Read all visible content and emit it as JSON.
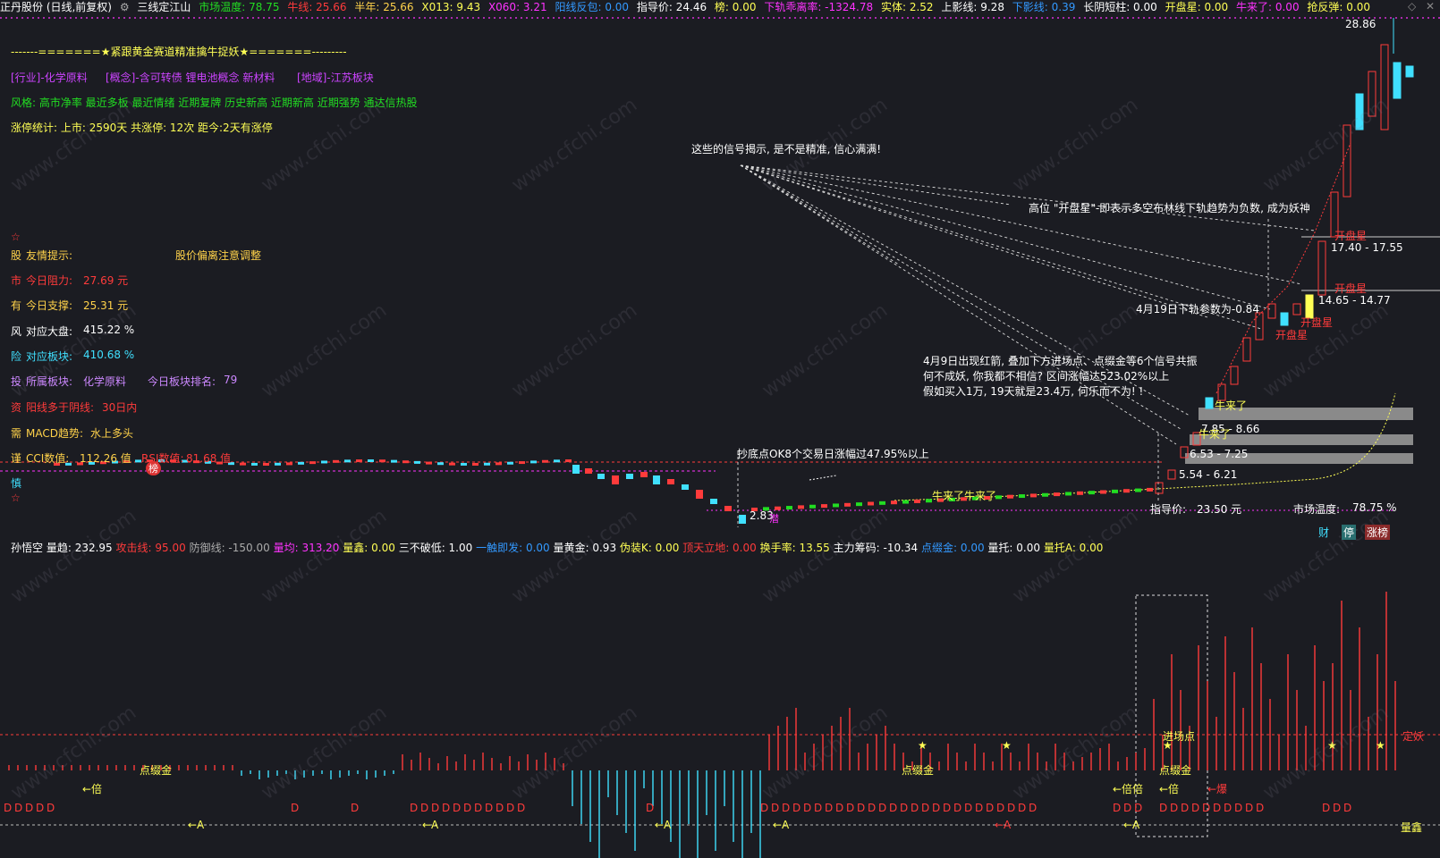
{
  "topbar": {
    "stock_name": "正丹股份 (日线,前复权)",
    "settings_icon": "gear-icon",
    "indicator_name": "三线定江山",
    "market_temp": "市场温度: 78.75",
    "bull_line": "牛线: 25.66",
    "half_year": "半年: 25.66",
    "x013": "X013: 9.43",
    "x060": "X060: 3.21",
    "yang_fan": "阳线反包: 0.00",
    "guide_price": "指导价: 24.46",
    "bang": "榜: 0.00",
    "lower_rail_rate": "下轨乖离率: -1324.78",
    "solid": "实体: 2.52",
    "upper_shadow": "上影线: 9.28",
    "lower_shadow": "下影线: 0.39",
    "long_short": "长阴短柱: 0.00",
    "open_star": "开盘星: 0.00",
    "bull_came": "牛来了: 0.00",
    "rebound": "抢反弹: 0.00"
  },
  "info": {
    "banner": "-------=======★紧跟黄金赛道精准擒牛捉妖★=======---------",
    "industry": "[行业]-化学原料",
    "concept": "[概念]-含可转债 锂电池概念 新材料",
    "region": "[地域]-江苏板块",
    "style": "风格: 高市净率 最近多板 最近情绪 近期复牌 历史新高 近期新高 近期强势 通达信热股",
    "limit_stats": "涨停统计:    上市: 2590天    共涨停: 12次    距今:2天有涨停",
    "star1": "☆",
    "tip_label": "友情提示:",
    "tip_value": "股价偏离注意调整",
    "resist_label": "今日阻力:",
    "resist_value": "27.69 元",
    "support_label": "今日支撑:",
    "support_value": "25.31 元",
    "market_label": "对应大盘:",
    "market_value": "415.22 %",
    "sector_label": "对应板块:",
    "sector_value": "410.68 %",
    "belong_label": "所属板块:",
    "belong_value": "化学原料",
    "rank_label": "今日板块排名:",
    "rank_value": "79",
    "yang_label": "阳线多于阴线:",
    "yang_value": "30日内",
    "macd_label": "MACD趋势:",
    "macd_value": "水上多头",
    "cci_label": "CCI数值:",
    "cci_value": "112.26 值",
    "rsi_label": "RSI数值:",
    "rsi_value": "81.68 值",
    "side_chars": [
      "股",
      "市",
      "有",
      "风",
      "险",
      "投",
      "资",
      "需",
      "谨",
      "慎"
    ],
    "star2": "☆"
  },
  "annotations": {
    "signal_title": "这些的信号揭示, 是不是精准, 信心满满!",
    "high_open_star": "高位 \"开盘星\"-即表示多空布林线下轨趋势为负数, 成为妖神",
    "apr19": "4月19日下轨参数为-0.84",
    "apr9_1": "4月9日出现红箭, 叠加下方进场点、点缀金等6个信号共振",
    "apr9_2": "何不成妖, 你我都不相信? 区间涨幅达523.02%以上",
    "apr9_3": "假如买入1万, 19天就是23.4万, 何乐而不为! !",
    "bottom_note": "抄底点OK8个交易日涨幅过47.95%以上",
    "price_high": "28.86",
    "range1": "17.40 - 17.55",
    "range2": "14.65 - 14.77",
    "range3": "7.85 - 8.66",
    "range4": "6.53 - 7.25",
    "range5": "5.54 - 6.21",
    "low_price": "2.83",
    "open_star_a": "开盘星",
    "open_star_b": "开盘星",
    "open_star_c": "开盘星",
    "open_star_d": "开盘星",
    "bull_came_a": "牛来了",
    "bull_came_b": "牛来了",
    "bull_came_c": "牛来了",
    "bull_came_d": "牛来了",
    "guide_label": "指导价:",
    "guide_value": "23.50 元",
    "temp_label": "市场温度:",
    "temp_value": "78.75 %",
    "cai": "财",
    "ting": "停",
    "zhangting": "涨榜",
    "bang_tag": "榜",
    "jian_tag": "潜"
  },
  "sub": {
    "name": "孙悟空",
    "vol_trend": "量趋: 232.95",
    "attack": "攻击线: 95.00",
    "defense": "防御线: -150.00",
    "vol_avg": "量均: 313.20",
    "vol_xin": "量鑫: 0.00",
    "three_nobreak": "三不破低: 1.00",
    "touch": "一触即发: 0.00",
    "vol_gold": "量黄金: 0.93",
    "fake_k": "伪装K: 0.00",
    "top_sky": "顶天立地: 0.00",
    "turnover": "换手率: 13.55",
    "main_chip": "主力筹码: -10.34",
    "dot_gold": "点缀金: 0.00",
    "vol_support": "量托: 0.00",
    "vol_support_a": "量托A: 0.00",
    "labels": {
      "bei1": "←倍",
      "dianzhui1": "点缀金",
      "dianzhui2": "点缀金",
      "dianzhui3": "点缀金",
      "jinchang": "进场点",
      "beibei": "←倍倍",
      "bei2": "←倍",
      "bao": "←爆",
      "dingyao": "定妖",
      "liangxin": "量鑫",
      "arrowA": "←A",
      "D": "D"
    }
  },
  "watermark": "www.cfchi.com",
  "colors": {
    "bg": "#1b1c22",
    "red": "#ff3b3b",
    "cyan": "#40e0ff",
    "yellow": "#ffff55",
    "magenta": "#ff33ff",
    "green": "#22dd22",
    "gold": "#f0d060"
  }
}
